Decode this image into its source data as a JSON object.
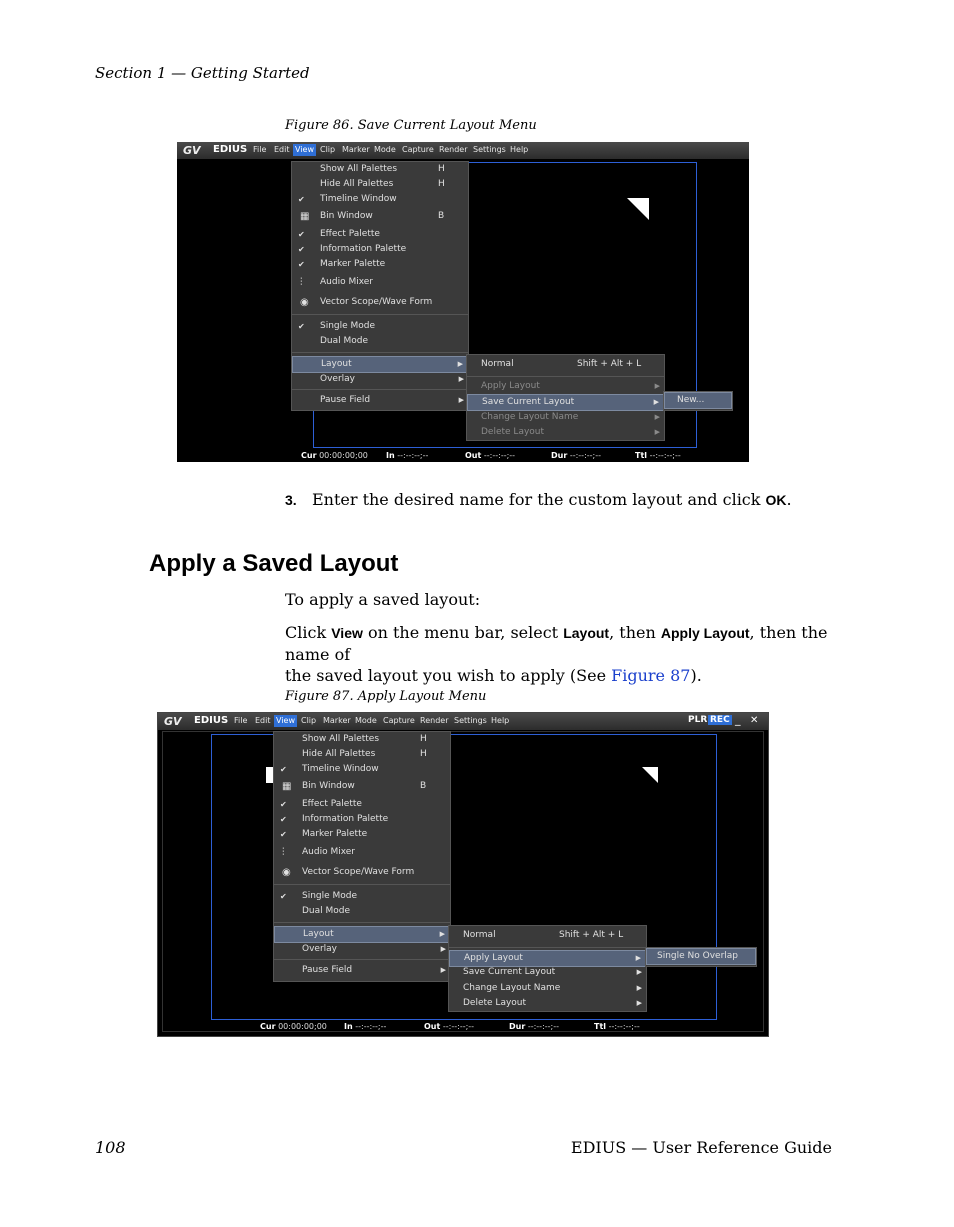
{
  "header": {
    "section": "Section 1 — Getting Started"
  },
  "fig86": {
    "caption": "Figure 86.  Save Current Layout Menu",
    "app": {
      "logo": "GV",
      "brand": "EDIUS"
    },
    "menus": [
      "File",
      "Edit",
      "View",
      "Clip",
      "Marker",
      "Mode",
      "Capture",
      "Render",
      "Settings",
      "Help"
    ],
    "view_menu": [
      {
        "label": "Show All Palettes",
        "key": "H"
      },
      {
        "label": "Hide All Palettes",
        "key": "H"
      },
      {
        "label": "Timeline Window",
        "check": "✔"
      },
      {
        "label": "Bin Window",
        "key": "B"
      },
      {
        "label": "Effect Palette",
        "check": "✔"
      },
      {
        "label": "Information Palette",
        "check": "✔"
      },
      {
        "label": "Marker Palette",
        "check": "✔"
      },
      {
        "label": "Audio Mixer"
      },
      {
        "label": "Vector Scope/Wave Form"
      },
      {
        "label": "Single Mode",
        "check": "✔"
      },
      {
        "label": "Dual Mode"
      },
      {
        "label": "Layout"
      },
      {
        "label": "Overlay"
      },
      {
        "label": "Pause Field"
      }
    ],
    "layout_menu": [
      {
        "label": "Normal",
        "key": "Shift + Alt + L"
      },
      {
        "label": "Apply Layout"
      },
      {
        "label": "Save Current Layout"
      },
      {
        "label": "Change Layout Name"
      },
      {
        "label": "Delete Layout"
      }
    ],
    "sub_menu": [
      "New..."
    ],
    "status": {
      "cur": "Cur",
      "cur_v": "00:00:00;00",
      "in": "In",
      "in_v": "--:--:--;--",
      "out": "Out",
      "out_v": "--:--:--;--",
      "dur": "Dur",
      "dur_v": "--:--:--;--",
      "ttl": "Ttl",
      "ttl_v": "--:--:--;--"
    }
  },
  "step3": {
    "num": "3.",
    "text_a": "Enter the desired name for the custom layout and click ",
    "ok": "OK",
    "text_b": "."
  },
  "section_title": "Apply a Saved Layout",
  "intro": "To apply a saved layout:",
  "instr": {
    "a": "Click ",
    "view": "View",
    "b": " on the menu bar, select ",
    "layout": "Layout",
    "c": ", then ",
    "apply": "Apply Layout",
    "d": ", then the name of",
    "line2a": "the saved layout you wish to apply (See ",
    "link": "Figure 87",
    "line2b": ")."
  },
  "fig87": {
    "caption": "Figure 87.  Apply Layout Menu",
    "title_right": {
      "plr": "PLR",
      "rec": "REC",
      "min": "_",
      "close": "✕"
    },
    "sub_menu": [
      "Single No Overlap"
    ]
  },
  "footer": {
    "page": "108",
    "guide": "EDIUS  —  User Reference Guide"
  }
}
